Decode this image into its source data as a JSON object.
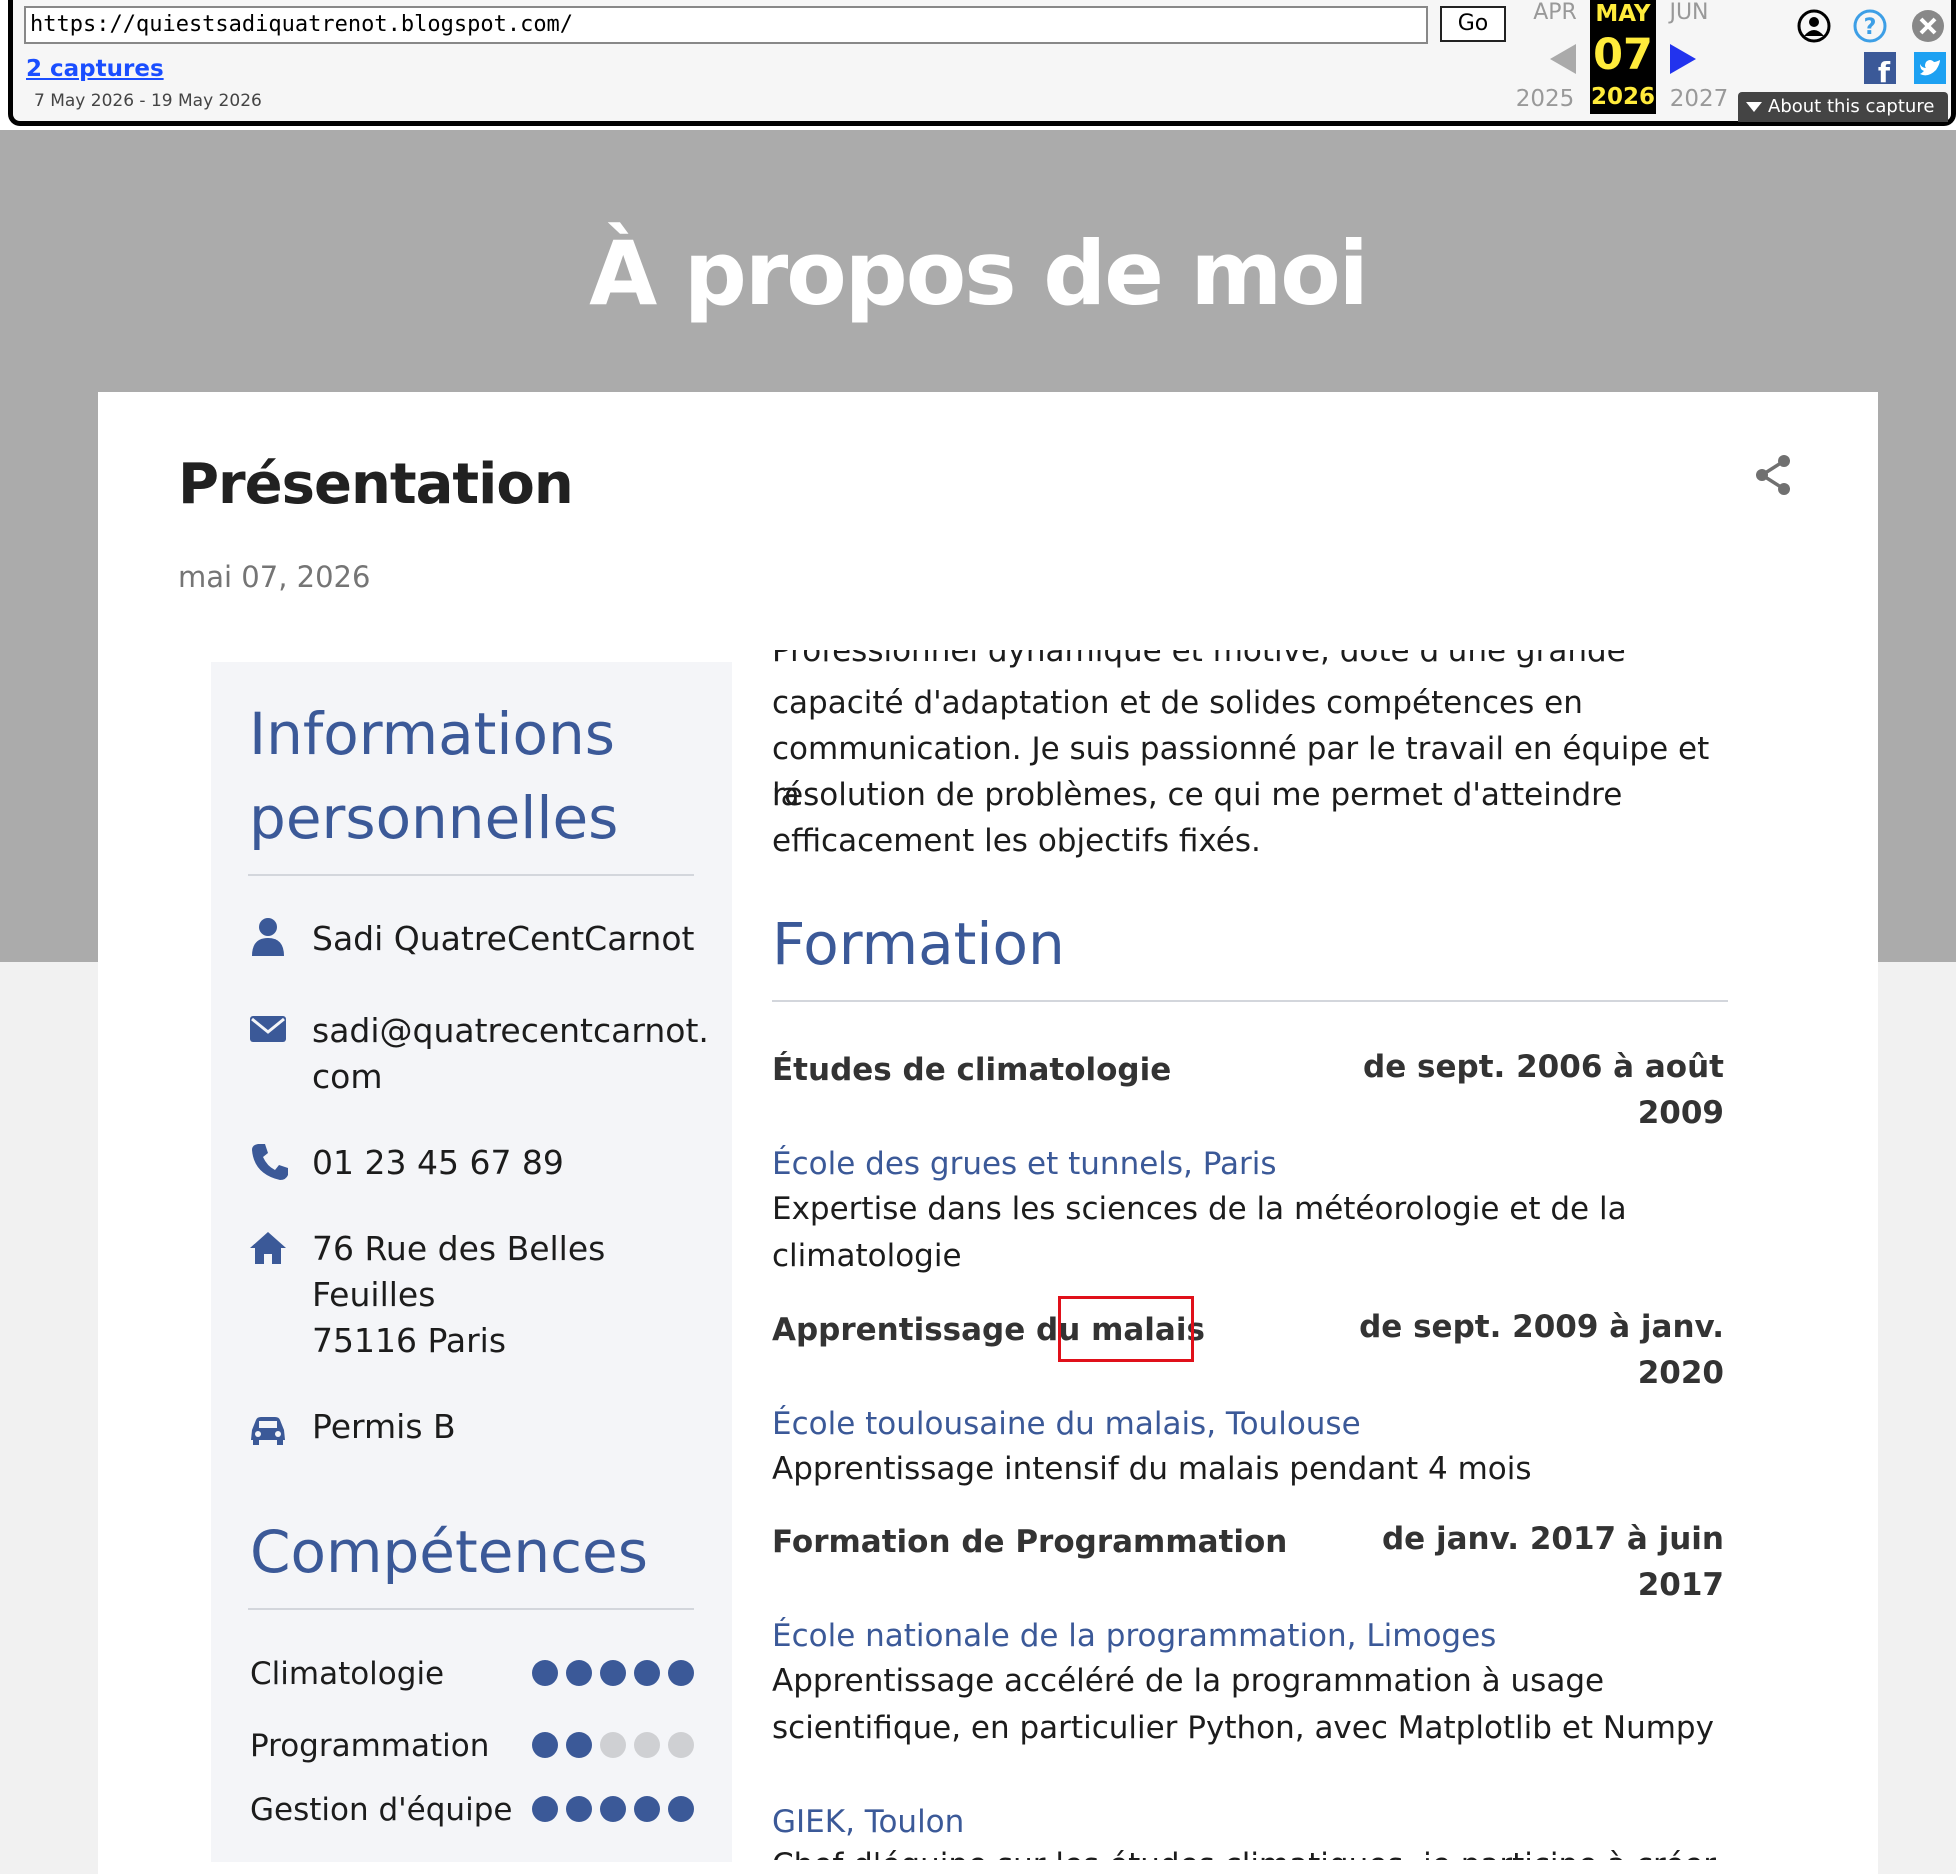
{
  "wayback": {
    "url": "https://quiestsadiquatrenot.blogspot.com/",
    "go_label": "Go",
    "captures_link": "2 captures",
    "date_range": "7 May 2026 - 19 May 2026",
    "prev_month": "APR",
    "prev_year": "2025",
    "current_month": "MAY",
    "current_day": "07",
    "current_year": "2026",
    "next_month": "JUN",
    "next_year": "2027",
    "about_capture": "About this capture",
    "icons": [
      "account-icon",
      "help-icon",
      "close-icon",
      "facebook-icon",
      "twitter-icon"
    ]
  },
  "blog": {
    "title": "À propos de moi"
  },
  "post": {
    "title": "Présentation",
    "date": "mai 07, 2026"
  },
  "cv": {
    "info_heading_line1": "Informations",
    "info_heading_line2": "personnelles",
    "name": "Sadi QuatreCentCarnot",
    "email_line1": "sadi@quatrecentcarnot.",
    "email_line2": "com",
    "phone": "01 23 45 67 89",
    "address_line1": "76 Rue des Belles",
    "address_line2": "Feuilles",
    "address_line3": "75116 Paris",
    "license": "Permis B",
    "skills_heading": "Compétences",
    "skills": [
      {
        "name": "Climatologie",
        "level": 5,
        "max": 5
      },
      {
        "name": "Programmation",
        "level": 2,
        "max": 5
      },
      {
        "name": "Gestion d'équipe",
        "level": 5,
        "max": 5
      }
    ],
    "intro_cut": "Professionnel dynamique et motivé, doté d'une grande",
    "intro_line2": "capacité d'adaptation et de solides compétences en",
    "intro_line3": "communication. Je suis passionné par le travail en équipe et la",
    "intro_line4": "résolution de problèmes, ce qui me permet d'atteindre",
    "intro_line5": "efficacement les objectifs fixés.",
    "formation_heading": "Formation",
    "education": [
      {
        "title": "Études de climatologie",
        "date_line1": "de sept. 2006 à août",
        "date_line2": "2009",
        "school": "École des grues et tunnels, Paris",
        "desc_line1": "Expertise dans les sciences de la météorologie et de la",
        "desc_line2": "climatologie"
      },
      {
        "title": "Apprentissage du malais",
        "date_line1": "de sept. 2009 à janv.",
        "date_line2": "2020",
        "school": "École toulousaine du malais, Toulouse",
        "desc_line1": "Apprentissage intensif du malais pendant 4 mois"
      },
      {
        "title": "Formation de Programmation",
        "date_line1": "de janv. 2017 à juin",
        "date_line2": "2017",
        "school": "École nationale de la programmation, Limoges",
        "desc_line1": "Apprentissage accéléré de la programmation à usage",
        "desc_line2": "scientifique, en particulier Python, avec Matplotlib et Numpy"
      }
    ],
    "extra_school": "GIEK, Toulon",
    "extra_cut": "Chef d'équipe sur les études climatiques, je participe à créer"
  },
  "colors": {
    "accent": "#3b5998",
    "header_band": "#ababab",
    "highlight": "#e0101a"
  }
}
